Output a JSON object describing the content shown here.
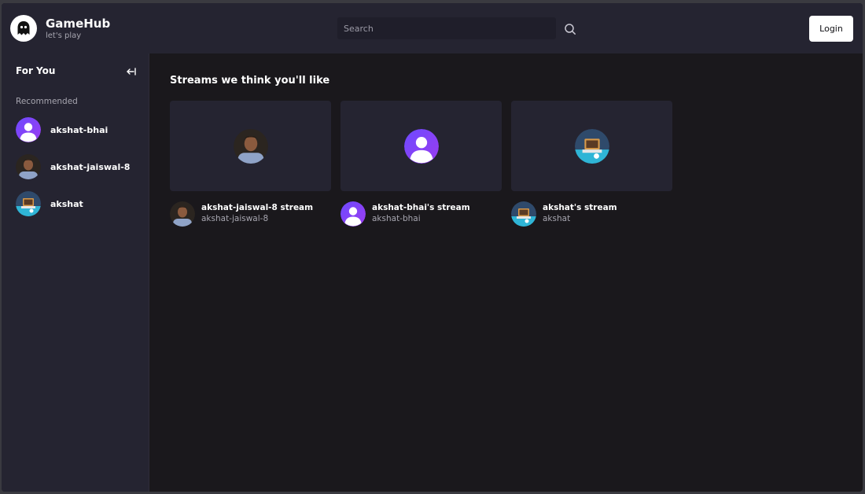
{
  "header": {
    "brand_name": "GameHub",
    "brand_tagline": "let's play",
    "search_placeholder": "Search",
    "login_label": "Login",
    "icons": {
      "logo": "ghost-icon",
      "search": "search-icon"
    }
  },
  "sidebar": {
    "title": "For You",
    "collapse_icon": "collapse-left-icon",
    "section_label": "Recommended",
    "items": [
      {
        "name": "akshat-bhai",
        "avatar": "default-user-avatar"
      },
      {
        "name": "akshat-jaiswal-8",
        "avatar": "photo-avatar"
      },
      {
        "name": "akshat",
        "avatar": "illustration-avatar"
      }
    ]
  },
  "main": {
    "title": "Streams we think you'll like",
    "streams": [
      {
        "title": "akshat-jaiswal-8 stream",
        "user": "akshat-jaiswal-8",
        "avatar": "photo-avatar"
      },
      {
        "title": "akshat-bhai's stream",
        "user": "akshat-bhai",
        "avatar": "default-user-avatar"
      },
      {
        "title": "akshat's stream",
        "user": "akshat",
        "avatar": "illustration-avatar"
      }
    ]
  },
  "colors": {
    "background": "#1a181c",
    "panel": "#252431",
    "accent_purple": "#7c3aed",
    "muted_text": "#a7a6b0"
  }
}
